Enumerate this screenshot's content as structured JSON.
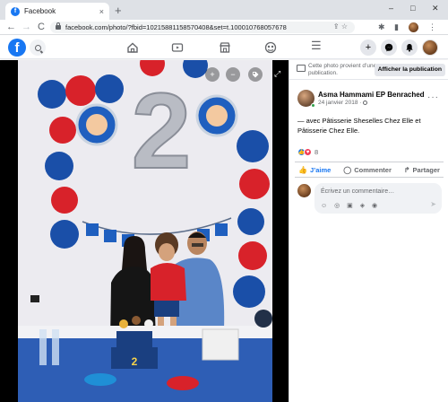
{
  "browser": {
    "tab_title": "Facebook",
    "tab_close": "×",
    "new_tab": "+",
    "url": "facebook.com/photo/?fbid=10215881158570408&set=t.100010768057678",
    "back": "←",
    "forward": "→",
    "reload": "C",
    "minimize": "–",
    "maximize": "□",
    "close": "✕"
  },
  "header": {
    "logo": "f",
    "create": "+",
    "menu": "☰"
  },
  "photo": {
    "zoom_in": "+",
    "zoom_out": "−",
    "balloon_number": "2",
    "cake_number": "2"
  },
  "panel": {
    "notice_text": "Cette photo provient d’une publication.",
    "notice_button": "Afficher la publication",
    "author": "Asma Hammami EP Benrached",
    "date": "24 janvier 2018 ·",
    "more": "···",
    "caption": "— avec Pâtisserie Sheselles Chez Elle et Pâtisserie Chez Elle.",
    "reaction_count": "8",
    "like": "J’aime",
    "comment": "Commenter",
    "share": "Partager",
    "comment_placeholder": "Écrivez un commentaire…",
    "comment_tools": "☺ ◎ ▣ ◈ ◉",
    "send": "➤"
  },
  "colors": {
    "facebook_blue": "#1877f2",
    "love_red": "#f33e58",
    "balloon_blue": "#1a4fa8",
    "balloon_red": "#d8222a"
  }
}
